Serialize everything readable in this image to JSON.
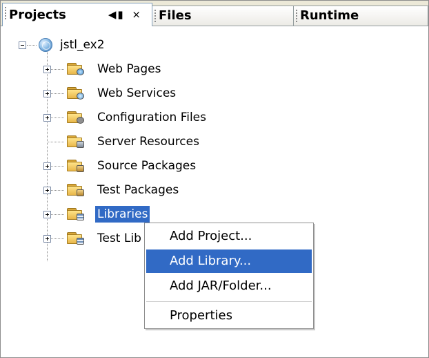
{
  "tabs": [
    {
      "label": "Projects",
      "active": true,
      "minimize_icon": "◀▮",
      "close_icon": "×"
    },
    {
      "label": "Files",
      "active": false
    },
    {
      "label": "Runtime",
      "active": false
    }
  ],
  "tree": {
    "root": {
      "label": "jstl_ex2",
      "icon": "globe-icon",
      "expanded": true
    },
    "children": [
      {
        "label": "Web Pages",
        "icon": "web-pages-folder-icon",
        "expandable": true
      },
      {
        "label": "Web Services",
        "icon": "web-services-folder-icon",
        "expandable": true
      },
      {
        "label": "Configuration Files",
        "icon": "configuration-files-folder-icon",
        "expandable": true
      },
      {
        "label": "Server Resources",
        "icon": "server-resources-folder-icon",
        "expandable": false
      },
      {
        "label": "Source Packages",
        "icon": "source-packages-folder-icon",
        "expandable": true
      },
      {
        "label": "Test Packages",
        "icon": "test-packages-folder-icon",
        "expandable": true
      },
      {
        "label": "Libraries",
        "icon": "libraries-folder-icon",
        "expandable": true,
        "selected": true
      },
      {
        "label": "Test Lib",
        "icon": "test-libraries-folder-icon",
        "expandable": true
      }
    ]
  },
  "context_menu": {
    "items": [
      {
        "label": "Add Project...",
        "highlighted": false
      },
      {
        "label": "Add Library...",
        "highlighted": true
      },
      {
        "label": "Add JAR/Folder...",
        "highlighted": false
      },
      {
        "label": "Properties",
        "highlighted": false
      }
    ]
  },
  "colors": {
    "selection": "#316ac5",
    "tab_bar": "#ece9d8",
    "folder": "#e8b64a"
  }
}
